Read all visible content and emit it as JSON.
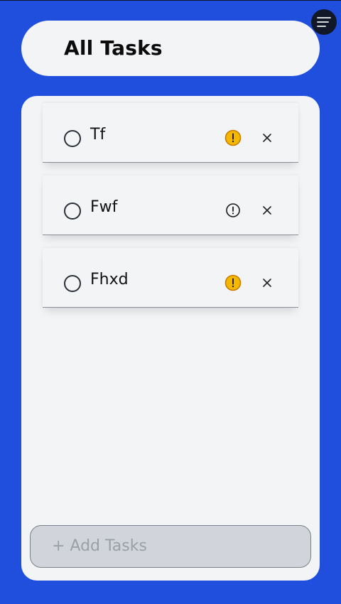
{
  "header": {
    "title": "All Tasks"
  },
  "menu": {
    "icon": "hamburger-menu-icon"
  },
  "tasks": [
    {
      "label": "Tf",
      "completed": false,
      "priority": "high",
      "priority_icon": "alert-circle-icon"
    },
    {
      "label": "Fwf",
      "completed": false,
      "priority": "normal",
      "priority_icon": "alert-circle-icon"
    },
    {
      "label": "Fhxd",
      "completed": false,
      "priority": "high",
      "priority_icon": "alert-circle-icon"
    }
  ],
  "add_task": {
    "label": "+ Add Tasks"
  },
  "colors": {
    "background": "#1f4fdc",
    "surface": "#f3f4f6",
    "priority_high": "#f5b800",
    "priority_high_stroke": "#c77d00",
    "menu_button": "#111827"
  }
}
